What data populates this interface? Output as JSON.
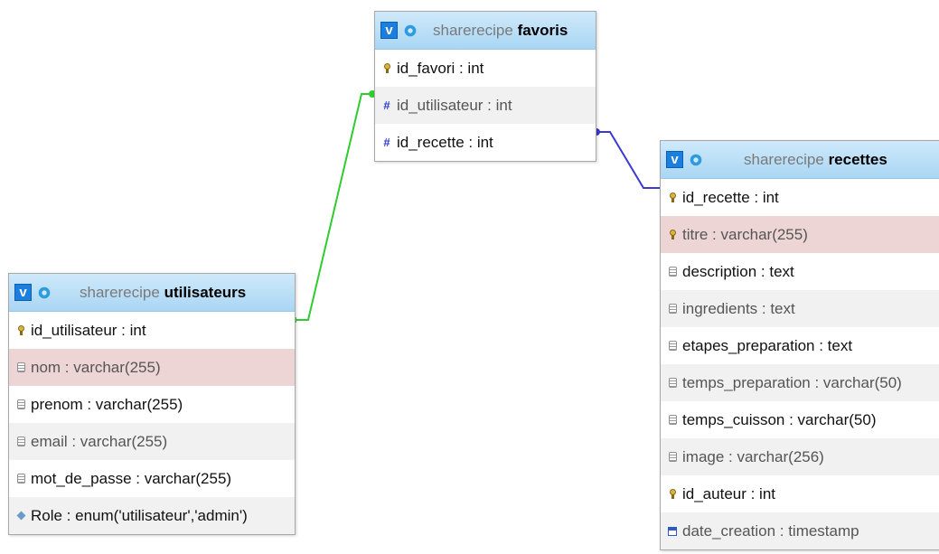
{
  "colors": {
    "header_gradient_top": "#cfe9fa",
    "header_gradient_bottom": "#a9d6f4",
    "link_utilisateur": "#2ecc2e",
    "link_recette": "#3a3ad0",
    "highlight_row": "#eed5d5"
  },
  "tables": {
    "favoris": {
      "schema": "sharerecipe",
      "name": "favoris",
      "toggle_label": "v",
      "columns": [
        {
          "text": "id_favori : int",
          "icon": "primary-key-icon"
        },
        {
          "text": "id_utilisateur : int",
          "icon": "index-hash-icon"
        },
        {
          "text": "id_recette : int",
          "icon": "index-hash-icon"
        }
      ]
    },
    "recettes": {
      "schema": "sharerecipe",
      "name": "recettes",
      "toggle_label": "v",
      "columns": [
        {
          "text": "id_recette : int",
          "icon": "primary-key-icon"
        },
        {
          "text": "titre : varchar(255)",
          "icon": "key-icon"
        },
        {
          "text": "description : text",
          "icon": "column-icon"
        },
        {
          "text": "ingredients : text",
          "icon": "column-icon"
        },
        {
          "text": "etapes_preparation : text",
          "icon": "column-icon"
        },
        {
          "text": "temps_preparation : varchar(50)",
          "icon": "column-icon"
        },
        {
          "text": "temps_cuisson : varchar(50)",
          "icon": "column-icon"
        },
        {
          "text": "image : varchar(256)",
          "icon": "column-icon"
        },
        {
          "text": "id_auteur : int",
          "icon": "key-icon"
        },
        {
          "text": "date_creation : timestamp",
          "icon": "date-icon"
        }
      ]
    },
    "utilisateurs": {
      "schema": "sharerecipe",
      "name": "utilisateurs",
      "toggle_label": "v",
      "columns": [
        {
          "text": "id_utilisateur : int",
          "icon": "primary-key-icon"
        },
        {
          "text": "nom : varchar(255)",
          "icon": "column-icon"
        },
        {
          "text": "prenom : varchar(255)",
          "icon": "column-icon"
        },
        {
          "text": "email : varchar(255)",
          "icon": "column-icon"
        },
        {
          "text": "mot_de_passe : varchar(255)",
          "icon": "column-icon"
        },
        {
          "text": "Role : enum('utilisateur','admin')",
          "icon": "enum-icon"
        }
      ]
    }
  }
}
